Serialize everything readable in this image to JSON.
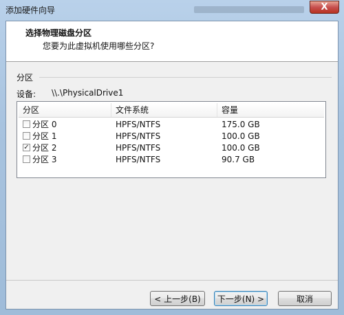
{
  "window": {
    "title": "添加硬件向导",
    "close_label": "X",
    "accent": "#a8c3df"
  },
  "header": {
    "title": "选择物理磁盘分区",
    "subtitle": "您要为此虚拟机使用哪些分区?"
  },
  "partitions_section": {
    "label": "分区",
    "device_label": "设备:",
    "device_value": "\\\\.\\PhysicalDrive1"
  },
  "table": {
    "columns": [
      "分区",
      "文件系统",
      "容量"
    ],
    "rows": [
      {
        "name": "分区 0",
        "fs": "HPFS/NTFS",
        "size": "175.0 GB",
        "checked": false
      },
      {
        "name": "分区 1",
        "fs": "HPFS/NTFS",
        "size": "100.0 GB",
        "checked": false
      },
      {
        "name": "分区 2",
        "fs": "HPFS/NTFS",
        "size": "100.0 GB",
        "checked": true
      },
      {
        "name": "分区 3",
        "fs": "HPFS/NTFS",
        "size": "90.7 GB",
        "checked": false
      }
    ]
  },
  "buttons": {
    "back": "< 上一步(B)",
    "next": "下一步(N) >",
    "cancel": "取消"
  }
}
